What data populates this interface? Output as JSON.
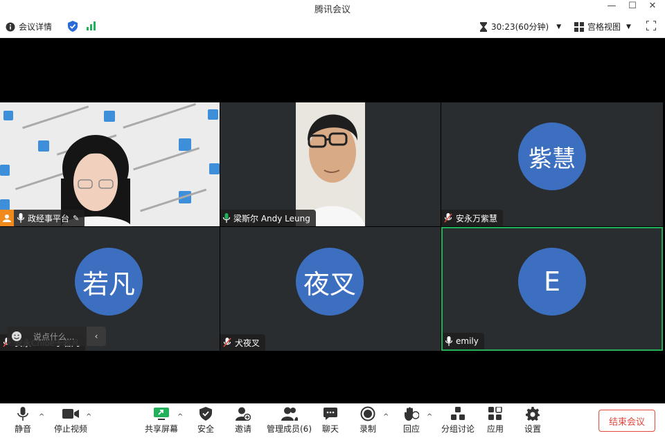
{
  "window": {
    "title": "腾讯会议",
    "minimize": "—",
    "maximize": "☐",
    "close": "✕"
  },
  "infobar": {
    "meeting_details": "会议详情",
    "timer": "30:23(60分钟)",
    "view_mode": "宫格视图"
  },
  "participants": [
    {
      "name": "政经事平台",
      "type": "video-person",
      "host": true,
      "mic": "on"
    },
    {
      "name": "梁斯尔 Andy Leung",
      "type": "video-person",
      "mic": "on"
    },
    {
      "name": "安永万紫慧",
      "avatar": "紫慧",
      "mic": "muted"
    },
    {
      "name": "安永Chloe于若凡",
      "avatar": "若凡",
      "mic": "muted"
    },
    {
      "name": "犬夜叉",
      "avatar": "夜叉",
      "mic": "muted"
    },
    {
      "name": "emily",
      "avatar": "E",
      "mic": "on",
      "active": true
    }
  ],
  "chat": {
    "placeholder": "说点什么...",
    "collapse_icon": "‹"
  },
  "toolbar": {
    "mute": "静音",
    "stop_video": "停止视频",
    "share_screen": "共享屏幕",
    "security": "安全",
    "invite": "邀请",
    "manage_members": "管理成员(6)",
    "chat": "聊天",
    "record": "录制",
    "reactions": "回应",
    "breakout": "分组讨论",
    "apps": "应用",
    "settings": "设置",
    "end_meeting": "结束会议"
  },
  "colors": {
    "accent_green": "#22b05b",
    "avatar_blue": "#3c6fc0",
    "end_red": "#e0483e",
    "host_orange": "#f08a1c"
  }
}
